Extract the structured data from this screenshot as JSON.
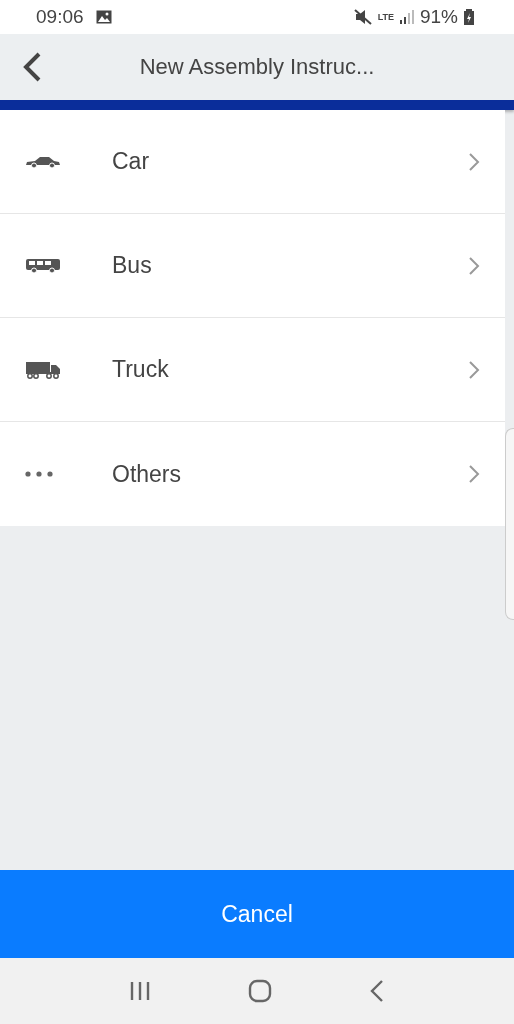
{
  "status_bar": {
    "time": "09:06",
    "network": "LTE",
    "battery": "91%"
  },
  "header": {
    "title": "New Assembly Instruc..."
  },
  "items": [
    {
      "kind": "car",
      "label": "Car"
    },
    {
      "kind": "bus",
      "label": "Bus"
    },
    {
      "kind": "truck",
      "label": "Truck"
    },
    {
      "kind": "more",
      "label": "Others"
    }
  ],
  "cancel_button": {
    "label": "Cancel"
  }
}
